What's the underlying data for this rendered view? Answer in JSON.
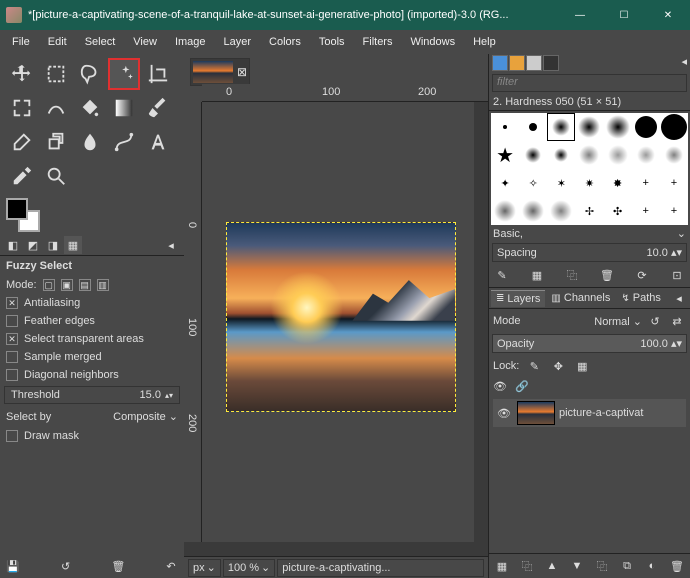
{
  "window": {
    "title": "*[picture-a-captivating-scene-of-a-tranquil-lake-at-sunset-ai-generative-photo] (imported)-3.0 (RG..."
  },
  "menu": {
    "file": "File",
    "edit": "Edit",
    "select": "Select",
    "view": "View",
    "image": "Image",
    "layer": "Layer",
    "colors": "Colors",
    "tools": "Tools",
    "filters": "Filters",
    "windows": "Windows",
    "help": "Help"
  },
  "toolopts": {
    "title": "Fuzzy Select",
    "mode": "Mode:",
    "antialias": "Antialiasing",
    "feather": "Feather edges",
    "transparent": "Select transparent areas",
    "sample": "Sample merged",
    "diagonal": "Diagonal neighbors",
    "threshold_label": "Threshold",
    "threshold_val": "15.0",
    "selectby_label": "Select by",
    "selectby_val": "Composite",
    "drawmask": "Draw mask"
  },
  "ruler": {
    "h0": "0",
    "h100": "100",
    "h200": "200",
    "v0": "0",
    "v100": "100",
    "v200": "200"
  },
  "status": {
    "px": "px",
    "zoom": "100 %",
    "file": "picture-a-captivating..."
  },
  "right": {
    "filter_placeholder": "filter",
    "brush_label": "2. Hardness 050 (51 × 51)",
    "basic": "Basic,",
    "spacing_label": "Spacing",
    "spacing_val": "10.0",
    "layers": "Layers",
    "channels": "Channels",
    "paths": "Paths",
    "mode": "Mode",
    "mode_val": "Normal",
    "opacity": "Opacity",
    "opacity_val": "100.0",
    "lock": "Lock:",
    "layer_name": "picture-a-captivat"
  }
}
